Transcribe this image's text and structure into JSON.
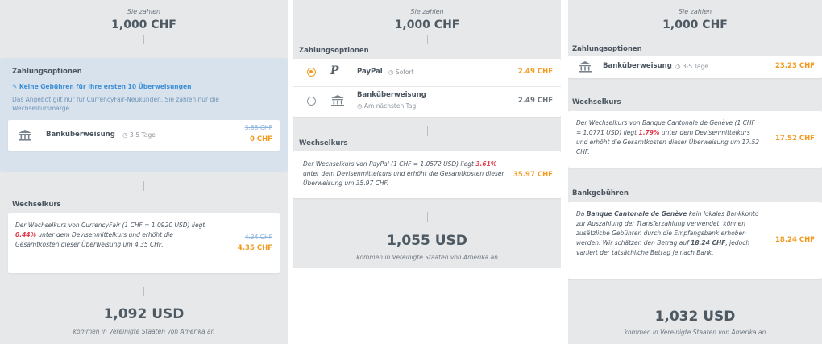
{
  "panel1": {
    "pay_label": "Sie zahlen",
    "pay_amount": "1,000 CHF",
    "options_title": "Zahlungsoptionen",
    "promo_title": "✎ Keine Gebühren für Ihre ersten 10 Überweisungen",
    "promo_text": "Das Angebot gilt nur für CurrencyFair-Neukunden. Sie zahlen nur die Wechselkursmarge.",
    "bank_name": "Banküberweisung",
    "bank_time": "◷ 3-5 Tage",
    "fee_old": "3.66 CHF",
    "fee_new": "0 CHF",
    "rate_title": "Wechselkurs",
    "rate_text_1": "Der Wechselkurs von CurrencyFair (1 CHF = 1.0920 USD) liegt ",
    "rate_percent": "0.44%",
    "rate_text_2": " unter dem Devisenmittelkurs und erhöht die Gesamtkosten dieser Überweisung um 4.35 CHF.",
    "rate_old": "4.34 CHF",
    "rate_new": "4.35 CHF",
    "receive_amount": "1,092 USD",
    "receive_label": "kommen in Vereinigte Staaten von Amerika an"
  },
  "panel2": {
    "pay_label": "Sie zahlen",
    "pay_amount": "1,000 CHF",
    "options_title": "Zahlungsoptionen",
    "paypal_name": "PayPal",
    "paypal_time": "◷ Sofort",
    "paypal_fee": "2.49 CHF",
    "bank_name": "Banküberweisung",
    "bank_time": "◷ Am nächsten Tag",
    "bank_fee": "2.49 CHF",
    "rate_title": "Wechselkurs",
    "rate_text_1": "Der Wechselkurs von PayPal (1 CHF = 1.0572 USD) liegt ",
    "rate_percent": "3.61%",
    "rate_text_2": " unter dem Devisenmittelkurs und erhöht die Gesamtkosten dieser Überweisung um 35.97 CHF.",
    "rate_cost": "35.97 CHF",
    "receive_amount": "1,055 USD",
    "receive_label": "kommen in Vereinigte Staaten von Amerika an"
  },
  "panel3": {
    "pay_label": "Sie zahlen",
    "pay_amount": "1,000 CHF",
    "options_title": "Zahlungsoptionen",
    "bank_name": "Banküberweisung",
    "bank_time": "◷ 3-5 Tage",
    "bank_fee": "23.23 CHF",
    "rate_title": "Wechselkurs",
    "rate_text_1": "Der Wechselkurs von Banque Cantonale de Genève (1 CHF = 1.0771 USD) liegt ",
    "rate_percent": "1.79%",
    "rate_text_2": " unter dem Devisenmittelkurs und erhöht die Gesamtkosten dieser Überweisung um 17.52 CHF.",
    "rate_cost": "17.52 CHF",
    "fees_title": "Bankgebühren",
    "fees_text_1": "Da ",
    "fees_bank": "Banque Cantonale de Genève",
    "fees_text_2": " kein lokales Bankkonto zur Auszahlung der Transferzahlung verwendet, können zusätzliche Gebühren durch die Empfangsbank erhoben werden. Wir schätzen den Betrag auf ",
    "fees_amount": "18.24 CHF",
    "fees_text_3": ", jedoch variiert der tatsächliche Betrag je nach Bank.",
    "fees_cost": "18.24 CHF",
    "receive_amount": "1,032 USD",
    "receive_label": "kommen in Vereinigte Staaten von Amerika an"
  },
  "icons": {
    "bank": "bank-icon",
    "paypal": "paypal-icon",
    "clock": "clock-icon",
    "tag": "tag-icon"
  },
  "colors": {
    "orange": "#f39a1e",
    "red": "#e0394a",
    "blue": "#3d8fd8",
    "panel_bg": "#e7e8ea",
    "highlight_bg": "#d8e2ec"
  }
}
